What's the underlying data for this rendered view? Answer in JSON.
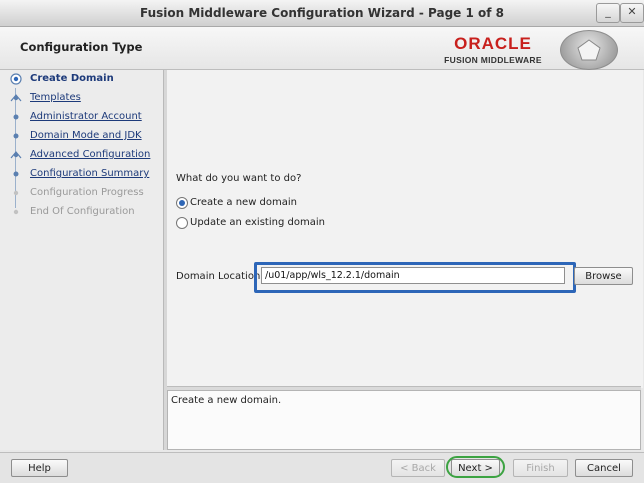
{
  "window": {
    "title": "Fusion Middleware Configuration Wizard - Page 1 of 8",
    "minimize_label": "_",
    "close_label": "✕"
  },
  "header": {
    "title": "Configuration Type",
    "logo_top": "ORACLE",
    "logo_bottom": "FUSION MIDDLEWARE"
  },
  "sidebar": {
    "items": [
      {
        "label": "Create Domain",
        "state": "active"
      },
      {
        "label": "Templates",
        "state": "link"
      },
      {
        "label": "Administrator Account",
        "state": "link"
      },
      {
        "label": "Domain Mode and JDK",
        "state": "link"
      },
      {
        "label": "Advanced Configuration",
        "state": "link"
      },
      {
        "label": "Configuration Summary",
        "state": "link"
      },
      {
        "label": "Configuration Progress",
        "state": "disabled"
      },
      {
        "label": "End Of Configuration",
        "state": "disabled"
      }
    ]
  },
  "main": {
    "question": "What do you want to do?",
    "options": [
      {
        "label": "Create a new domain",
        "selected": true
      },
      {
        "label": "Update an existing domain",
        "selected": false
      }
    ],
    "domain_location_label": "Domain Location:",
    "domain_location_value": "/u01/app/wls_12.2.1/domain",
    "browse_label": "Browse"
  },
  "description": {
    "text": "Create a new domain."
  },
  "footer": {
    "help_label": "Help",
    "back_label": "< Back",
    "next_label": "Next >",
    "finish_label": "Finish",
    "cancel_label": "Cancel"
  },
  "colors": {
    "accent_blue": "#2d66b8",
    "next_highlight": "#3ca342",
    "oracle_red": "#c8201d"
  }
}
